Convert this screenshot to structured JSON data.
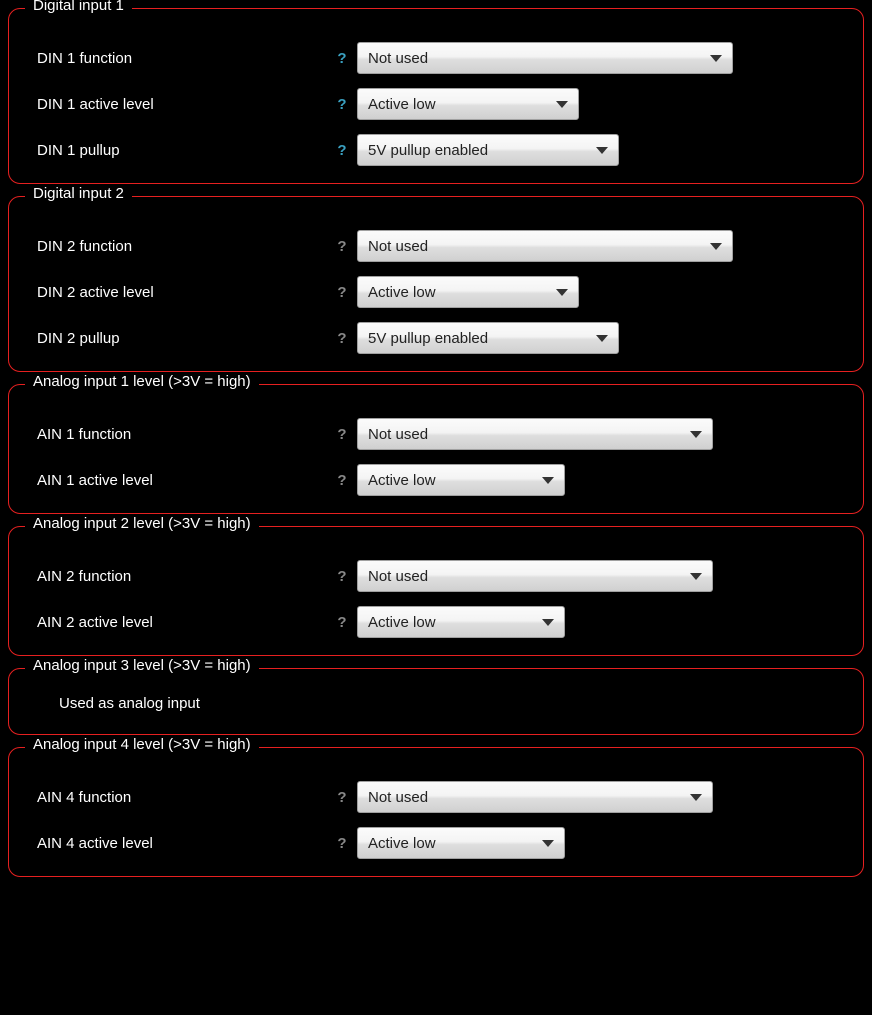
{
  "din1": {
    "title": "Digital input 1",
    "function_label": "DIN 1 function",
    "function_value": "Not used",
    "active_label": "DIN 1 active level",
    "active_value": "Active low",
    "pullup_label": "DIN 1 pullup",
    "pullup_value": "5V pullup enabled"
  },
  "din2": {
    "title": "Digital input 2",
    "function_label": "DIN 2 function",
    "function_value": "Not used",
    "active_label": "DIN 2 active level",
    "active_value": "Active low",
    "pullup_label": "DIN 2 pullup",
    "pullup_value": "5V pullup enabled"
  },
  "ain1": {
    "title": "Analog input 1 level (>3V = high)",
    "function_label": "AIN 1 function",
    "function_value": "Not used",
    "active_label": "AIN 1 active level",
    "active_value": "Active low"
  },
  "ain2": {
    "title": "Analog input 2 level (>3V = high)",
    "function_label": "AIN 2 function",
    "function_value": "Not used",
    "active_label": "AIN 2 active level",
    "active_value": "Active low"
  },
  "ain3": {
    "title": "Analog input 3 level (>3V = high)",
    "note": "Used as analog input"
  },
  "ain4": {
    "title": "Analog input 4 level (>3V = high)",
    "function_label": "AIN 4 function",
    "function_value": "Not used",
    "active_label": "AIN 4 active level",
    "active_value": "Active low"
  },
  "help_glyph": "?"
}
